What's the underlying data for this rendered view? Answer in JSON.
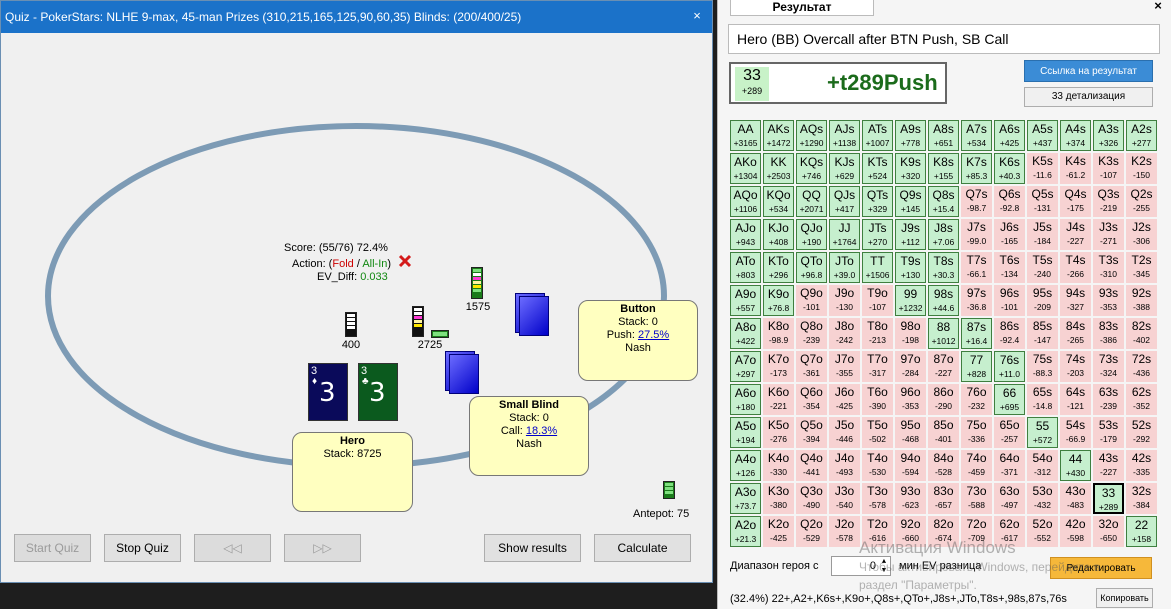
{
  "quiz": {
    "title": "Quiz - PokerStars: NLHE 9-max, 45-man Prizes (310,215,165,125,90,60,35) Blinds: (200/400/25)",
    "close_glyph": "×",
    "score_text": "Score: (55/76) 72.4%",
    "action_prefix": "Action: (",
    "action_fold": "Fold",
    "action_sep": " / ",
    "action_allin": "All-In",
    "action_suffix": ")",
    "ev_diff_label": "EV_Diff: ",
    "ev_diff_value": "0.033",
    "chip_labels": {
      "bb": "400",
      "sb": "2725",
      "btn": "1575"
    },
    "antepot": "Antepot: 75",
    "hero": {
      "name": "Hero",
      "stack": "Stack: 8725"
    },
    "small_blind": {
      "name": "Small Blind",
      "stack": "Stack: 0",
      "call_prefix": "Call: ",
      "call_value": "18.3%",
      "strategy": "Nash"
    },
    "button": {
      "name": "Button",
      "stack": "Stack: 0",
      "push_prefix": "Push: ",
      "push_value": "27.5%",
      "strategy": "Nash"
    },
    "cards": [
      {
        "rank": "3",
        "suit": "♦",
        "color": "#0a0a5a"
      },
      {
        "rank": "3",
        "suit": "♣",
        "color": "#0b5a1e"
      }
    ],
    "buttons": {
      "start": "Start Quiz",
      "stop": "Stop Quiz",
      "prev": "◁◁",
      "next": "▷▷",
      "show_results": "Show results",
      "calculate": "Calculate"
    }
  },
  "result": {
    "tab": "Результат",
    "close_glyph": "×",
    "heading": "Hero (BB) Overcall after BTN Push, SB Call",
    "hand": "33",
    "hand_ev": "+289",
    "big_result": "+t289Push",
    "link_button": "Ссылка на результат",
    "detail_button": "33 детализация",
    "range_label": "Диапазон героя с",
    "range_value": "0",
    "range_unit": "мин EV разница",
    "edit_button": "Редактировать",
    "range_text": "(32.4%) 22+,A2+,K6s+,K9o+,Q8s+,QTo+,J8s+,JTo,T8s+,98s,87s,76s",
    "copy_button": "Копировать"
  },
  "grid": [
    [
      [
        "AA",
        "+3165",
        1
      ],
      [
        "AKs",
        "+1472",
        1
      ],
      [
        "AQs",
        "+1290",
        1
      ],
      [
        "AJs",
        "+1138",
        1
      ],
      [
        "ATs",
        "+1007",
        1
      ],
      [
        "A9s",
        "+778",
        1
      ],
      [
        "A8s",
        "+651",
        1
      ],
      [
        "A7s",
        "+534",
        1
      ],
      [
        "A6s",
        "+425",
        1
      ],
      [
        "A5s",
        "+437",
        1
      ],
      [
        "A4s",
        "+374",
        1
      ],
      [
        "A3s",
        "+326",
        1
      ],
      [
        "A2s",
        "+277",
        1
      ]
    ],
    [
      [
        "AKo",
        "+1304",
        1
      ],
      [
        "KK",
        "+2503",
        1
      ],
      [
        "KQs",
        "+746",
        1
      ],
      [
        "KJs",
        "+629",
        1
      ],
      [
        "KTs",
        "+524",
        1
      ],
      [
        "K9s",
        "+320",
        1
      ],
      [
        "K8s",
        "+155",
        1
      ],
      [
        "K7s",
        "+85.3",
        1
      ],
      [
        "K6s",
        "+40.3",
        1
      ],
      [
        "K5s",
        "-11.6",
        0
      ],
      [
        "K4s",
        "-61.2",
        0
      ],
      [
        "K3s",
        "-107",
        0
      ],
      [
        "K2s",
        "-150",
        0
      ]
    ],
    [
      [
        "AQo",
        "+1106",
        1
      ],
      [
        "KQo",
        "+534",
        1
      ],
      [
        "QQ",
        "+2071",
        1
      ],
      [
        "QJs",
        "+417",
        1
      ],
      [
        "QTs",
        "+329",
        1
      ],
      [
        "Q9s",
        "+145",
        1
      ],
      [
        "Q8s",
        "+15.4",
        1
      ],
      [
        "Q7s",
        "-98.7",
        0
      ],
      [
        "Q6s",
        "-92.8",
        0
      ],
      [
        "Q5s",
        "-131",
        0
      ],
      [
        "Q4s",
        "-175",
        0
      ],
      [
        "Q3s",
        "-219",
        0
      ],
      [
        "Q2s",
        "-255",
        0
      ]
    ],
    [
      [
        "AJo",
        "+943",
        1
      ],
      [
        "KJo",
        "+408",
        1
      ],
      [
        "QJo",
        "+190",
        1
      ],
      [
        "JJ",
        "+1764",
        1
      ],
      [
        "JTs",
        "+270",
        1
      ],
      [
        "J9s",
        "+112",
        1
      ],
      [
        "J8s",
        "+7.06",
        1
      ],
      [
        "J7s",
        "-99.0",
        0
      ],
      [
        "J6s",
        "-165",
        0
      ],
      [
        "J5s",
        "-184",
        0
      ],
      [
        "J4s",
        "-227",
        0
      ],
      [
        "J3s",
        "-271",
        0
      ],
      [
        "J2s",
        "-306",
        0
      ]
    ],
    [
      [
        "ATo",
        "+803",
        1
      ],
      [
        "KTo",
        "+296",
        1
      ],
      [
        "QTo",
        "+96.8",
        1
      ],
      [
        "JTo",
        "+39.0",
        1
      ],
      [
        "TT",
        "+1506",
        1
      ],
      [
        "T9s",
        "+130",
        1
      ],
      [
        "T8s",
        "+30.3",
        1
      ],
      [
        "T7s",
        "-66.1",
        0
      ],
      [
        "T6s",
        "-134",
        0
      ],
      [
        "T5s",
        "-240",
        0
      ],
      [
        "T4s",
        "-266",
        0
      ],
      [
        "T3s",
        "-310",
        0
      ],
      [
        "T2s",
        "-345",
        0
      ]
    ],
    [
      [
        "A9o",
        "+557",
        1
      ],
      [
        "K9o",
        "+76.8",
        1
      ],
      [
        "Q9o",
        "-101",
        0
      ],
      [
        "J9o",
        "-130",
        0
      ],
      [
        "T9o",
        "-107",
        0
      ],
      [
        "99",
        "+1232",
        1
      ],
      [
        "98s",
        "+44.6",
        1
      ],
      [
        "97s",
        "-36.8",
        0
      ],
      [
        "96s",
        "-101",
        0
      ],
      [
        "95s",
        "-209",
        0
      ],
      [
        "94s",
        "-327",
        0
      ],
      [
        "93s",
        "-353",
        0
      ],
      [
        "92s",
        "-388",
        0
      ]
    ],
    [
      [
        "A8o",
        "+422",
        1
      ],
      [
        "K8o",
        "-98.9",
        0
      ],
      [
        "Q8o",
        "-239",
        0
      ],
      [
        "J8o",
        "-242",
        0
      ],
      [
        "T8o",
        "-213",
        0
      ],
      [
        "98o",
        "-198",
        0
      ],
      [
        "88",
        "+1012",
        1
      ],
      [
        "87s",
        "+16.4",
        1
      ],
      [
        "86s",
        "-92.4",
        0
      ],
      [
        "85s",
        "-147",
        0
      ],
      [
        "84s",
        "-265",
        0
      ],
      [
        "83s",
        "-386",
        0
      ],
      [
        "82s",
        "-402",
        0
      ]
    ],
    [
      [
        "A7o",
        "+297",
        1
      ],
      [
        "K7o",
        "-173",
        0
      ],
      [
        "Q7o",
        "-361",
        0
      ],
      [
        "J7o",
        "-355",
        0
      ],
      [
        "T7o",
        "-317",
        0
      ],
      [
        "97o",
        "-284",
        0
      ],
      [
        "87o",
        "-227",
        0
      ],
      [
        "77",
        "+828",
        1
      ],
      [
        "76s",
        "+11.0",
        1
      ],
      [
        "75s",
        "-88.3",
        0
      ],
      [
        "74s",
        "-203",
        0
      ],
      [
        "73s",
        "-324",
        0
      ],
      [
        "72s",
        "-436",
        0
      ]
    ],
    [
      [
        "A6o",
        "+180",
        1
      ],
      [
        "K6o",
        "-221",
        0
      ],
      [
        "Q6o",
        "-354",
        0
      ],
      [
        "J6o",
        "-425",
        0
      ],
      [
        "T6o",
        "-390",
        0
      ],
      [
        "96o",
        "-353",
        0
      ],
      [
        "86o",
        "-290",
        0
      ],
      [
        "76o",
        "-232",
        0
      ],
      [
        "66",
        "+695",
        1
      ],
      [
        "65s",
        "-14.8",
        0
      ],
      [
        "64s",
        "-121",
        0
      ],
      [
        "63s",
        "-239",
        0
      ],
      [
        "62s",
        "-352",
        0
      ]
    ],
    [
      [
        "A5o",
        "+194",
        1
      ],
      [
        "K5o",
        "-276",
        0
      ],
      [
        "Q5o",
        "-394",
        0
      ],
      [
        "J5o",
        "-446",
        0
      ],
      [
        "T5o",
        "-502",
        0
      ],
      [
        "95o",
        "-468",
        0
      ],
      [
        "85o",
        "-401",
        0
      ],
      [
        "75o",
        "-336",
        0
      ],
      [
        "65o",
        "-257",
        0
      ],
      [
        "55",
        "+572",
        1
      ],
      [
        "54s",
        "-66.9",
        0
      ],
      [
        "53s",
        "-179",
        0
      ],
      [
        "52s",
        "-292",
        0
      ]
    ],
    [
      [
        "A4o",
        "+126",
        1
      ],
      [
        "K4o",
        "-330",
        0
      ],
      [
        "Q4o",
        "-441",
        0
      ],
      [
        "J4o",
        "-493",
        0
      ],
      [
        "T4o",
        "-530",
        0
      ],
      [
        "94o",
        "-594",
        0
      ],
      [
        "84o",
        "-528",
        0
      ],
      [
        "74o",
        "-459",
        0
      ],
      [
        "64o",
        "-371",
        0
      ],
      [
        "54o",
        "-312",
        0
      ],
      [
        "44",
        "+430",
        1
      ],
      [
        "43s",
        "-227",
        0
      ],
      [
        "42s",
        "-335",
        0
      ]
    ],
    [
      [
        "A3o",
        "+73.7",
        1
      ],
      [
        "K3o",
        "-380",
        0
      ],
      [
        "Q3o",
        "-490",
        0
      ],
      [
        "J3o",
        "-540",
        0
      ],
      [
        "T3o",
        "-578",
        0
      ],
      [
        "93o",
        "-623",
        0
      ],
      [
        "83o",
        "-657",
        0
      ],
      [
        "73o",
        "-588",
        0
      ],
      [
        "63o",
        "-497",
        0
      ],
      [
        "53o",
        "-432",
        0
      ],
      [
        "43o",
        "-483",
        0
      ],
      [
        "33",
        "+289",
        1
      ],
      [
        "32s",
        "-384",
        0
      ]
    ],
    [
      [
        "A2o",
        "+21.3",
        1
      ],
      [
        "K2o",
        "-425",
        0
      ],
      [
        "Q2o",
        "-529",
        0
      ],
      [
        "J2o",
        "-578",
        0
      ],
      [
        "T2o",
        "-616",
        0
      ],
      [
        "92o",
        "-660",
        0
      ],
      [
        "82o",
        "-674",
        0
      ],
      [
        "72o",
        "-709",
        0
      ],
      [
        "62o",
        "-617",
        0
      ],
      [
        "52o",
        "-552",
        0
      ],
      [
        "42o",
        "-598",
        0
      ],
      [
        "32o",
        "-650",
        0
      ],
      [
        "22",
        "+158",
        1
      ]
    ]
  ],
  "watermark": {
    "line1": "Активация Windows",
    "line2": "Чтобы активировать Windows, перейдите в",
    "line3": "раздел \"Параметры\"."
  },
  "colors": {
    "titlebar": "#1b72c9",
    "fold": "#cc0000",
    "allin": "#118811",
    "good": "#c6efce",
    "bad": "#f7d2d2"
  }
}
